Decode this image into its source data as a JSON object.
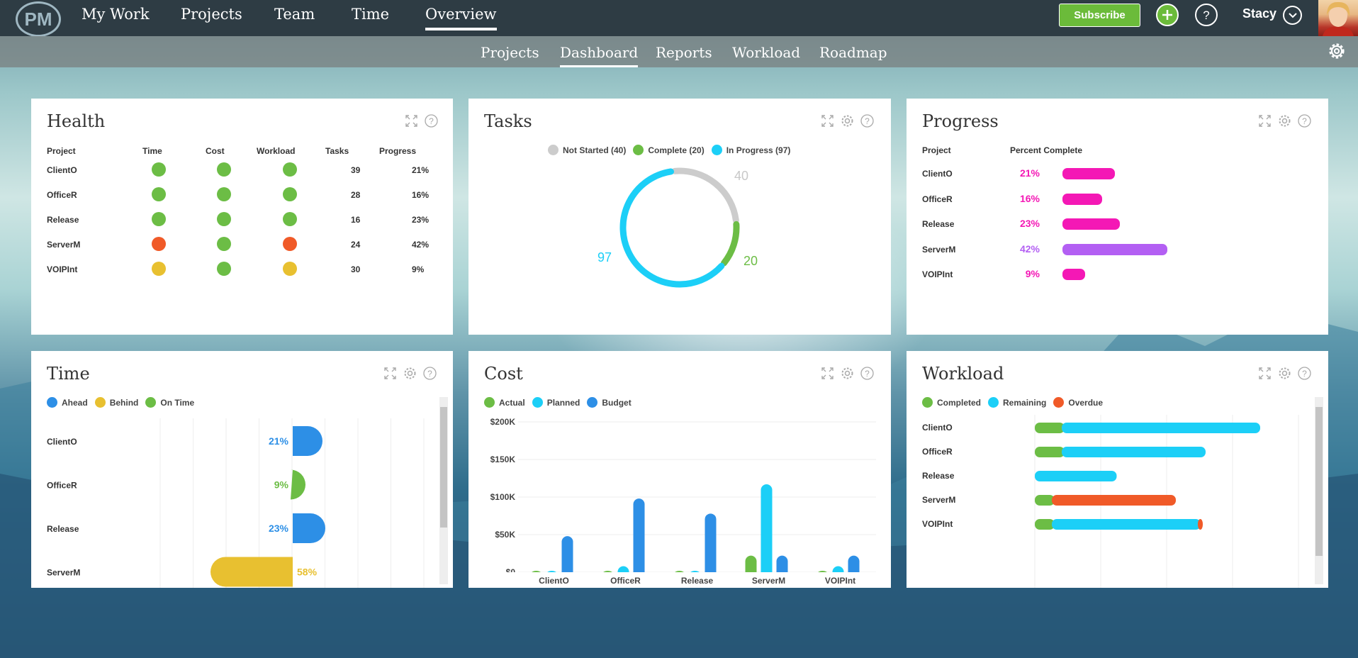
{
  "app": {
    "logo": "PM",
    "user_name": "Stacy"
  },
  "nav": {
    "items": [
      "My Work",
      "Projects",
      "Team",
      "Time",
      "Overview"
    ],
    "active": "Overview",
    "subscribe_label": "Subscribe"
  },
  "subnav": {
    "items": [
      "Projects",
      "Dashboard",
      "Reports",
      "Workload",
      "Roadmap"
    ],
    "active": "Dashboard"
  },
  "icons": [
    "plus-icon",
    "help-icon",
    "chevron-down-icon",
    "gear-icon",
    "expand-icon"
  ],
  "colors": {
    "green": "#6cbd45",
    "orange": "#f05a28",
    "yellow": "#e8c030",
    "cyan": "#1ccff7",
    "blue": "#2d8fe6",
    "pink": "#f418b5",
    "purple": "#b35ff3",
    "gray": "#cccccc"
  },
  "health": {
    "title": "Health",
    "headers": [
      "Project",
      "Time",
      "Cost",
      "Workload",
      "Tasks",
      "Progress"
    ],
    "rows": [
      {
        "project": "ClientO",
        "time": "green",
        "cost": "green",
        "workload": "green",
        "tasks": "39",
        "progress": "21%"
      },
      {
        "project": "OfficeR",
        "time": "green",
        "cost": "green",
        "workload": "green",
        "tasks": "28",
        "progress": "16%"
      },
      {
        "project": "Release",
        "time": "green",
        "cost": "green",
        "workload": "green",
        "tasks": "16",
        "progress": "23%"
      },
      {
        "project": "ServerM",
        "time": "orange",
        "cost": "green",
        "workload": "orange",
        "tasks": "24",
        "progress": "42%"
      },
      {
        "project": "VOIPInt",
        "time": "yellow",
        "cost": "green",
        "workload": "yellow",
        "tasks": "30",
        "progress": "9%"
      }
    ]
  },
  "tasks": {
    "title": "Tasks",
    "legend": [
      "Not Started (40)",
      "Complete (20)",
      "In Progress (97)"
    ],
    "labels": {
      "not_started": "40",
      "complete": "20",
      "in_progress": "97"
    }
  },
  "progress": {
    "title": "Progress",
    "headers": [
      "Project",
      "Percent Complete"
    ],
    "rows": [
      {
        "project": "ClientO",
        "percent": "21%",
        "value": 21,
        "color": "pink"
      },
      {
        "project": "OfficeR",
        "percent": "16%",
        "value": 16,
        "color": "pink"
      },
      {
        "project": "Release",
        "percent": "23%",
        "value": 23,
        "color": "pink"
      },
      {
        "project": "ServerM",
        "percent": "42%",
        "value": 42,
        "color": "purple"
      },
      {
        "project": "VOIPInt",
        "percent": "9%",
        "value": 9,
        "color": "pink"
      }
    ]
  },
  "time_panel": {
    "title": "Time",
    "legend": [
      "Ahead",
      "Behind",
      "On Time"
    ],
    "rows": [
      {
        "project": "ClientO",
        "percent": "21%",
        "value": 21,
        "status": "ahead"
      },
      {
        "project": "OfficeR",
        "percent": "9%",
        "value": 9,
        "status": "on_time"
      },
      {
        "project": "Release",
        "percent": "23%",
        "value": 23,
        "status": "ahead"
      },
      {
        "project": "ServerM",
        "percent": "58%",
        "value": -58,
        "status": "behind"
      }
    ]
  },
  "cost": {
    "title": "Cost",
    "legend": [
      "Actual",
      "Planned",
      "Budget"
    ]
  },
  "workload": {
    "title": "Workload",
    "legend": [
      "Completed",
      "Remaining",
      "Overdue"
    ],
    "rows": [
      "ClientO",
      "OfficeR",
      "Release",
      "ServerM",
      "VOIPInt"
    ]
  },
  "chart_data": [
    {
      "type": "pie",
      "title": "Tasks",
      "categories": [
        "Not Started",
        "Complete",
        "In Progress"
      ],
      "values": [
        40,
        20,
        97
      ]
    },
    {
      "type": "bar",
      "title": "Progress",
      "categories": [
        "ClientO",
        "OfficeR",
        "Release",
        "ServerM",
        "VOIPInt"
      ],
      "values": [
        21,
        16,
        23,
        42,
        9
      ],
      "xlabel": "Percent Complete"
    },
    {
      "type": "bar",
      "title": "Time",
      "categories": [
        "ClientO",
        "OfficeR",
        "Release",
        "ServerM"
      ],
      "values": [
        21,
        9,
        23,
        -58
      ],
      "series_status": [
        "Ahead",
        "On Time",
        "Ahead",
        "Behind"
      ]
    },
    {
      "type": "bar",
      "title": "Cost",
      "categories": [
        "ClientO",
        "OfficeR",
        "Release",
        "ServerM",
        "VOIPInt"
      ],
      "series": [
        {
          "name": "Actual",
          "values": [
            1000,
            500,
            500,
            22000,
            500
          ]
        },
        {
          "name": "Planned",
          "values": [
            500,
            8000,
            1000,
            117000,
            8000
          ]
        },
        {
          "name": "Budget",
          "values": [
            48000,
            98000,
            78000,
            22000,
            22000
          ]
        }
      ],
      "yticks": [
        "$0",
        "$50K",
        "$100K",
        "$150K",
        "$200K"
      ],
      "ylim": [
        0,
        200000
      ]
    },
    {
      "type": "bar",
      "title": "Workload",
      "categories": [
        "ClientO",
        "OfficeR",
        "Release",
        "ServerM",
        "VOIPInt"
      ],
      "series": [
        {
          "name": "Completed",
          "values": [
            12,
            12,
            0,
            8,
            8
          ]
        },
        {
          "name": "Remaining",
          "values": [
            80,
            58,
            33,
            0,
            60
          ]
        },
        {
          "name": "Overdue",
          "values": [
            0,
            0,
            0,
            50,
            2
          ]
        }
      ]
    }
  ]
}
